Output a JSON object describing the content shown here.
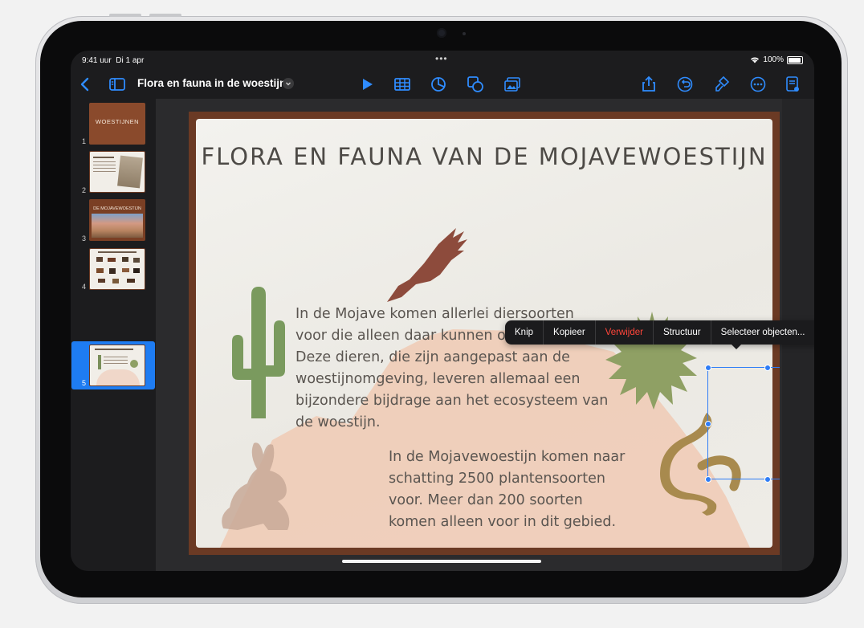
{
  "status": {
    "time": "9:41 uur",
    "date": "Di 1 apr",
    "battery": "100%"
  },
  "toolbar": {
    "document_title": "Flora en fauna in de woestijn",
    "icons": [
      "back-chevron-icon",
      "sidebar-icon",
      "play-icon",
      "table-icon",
      "chart-icon",
      "shape-icon",
      "media-icon",
      "share-icon",
      "undo-icon",
      "format-brush-icon",
      "more-icon",
      "document-icon"
    ]
  },
  "sidebar": {
    "slides": [
      {
        "number": "1",
        "label": "WOESTIJNEN"
      },
      {
        "number": "2",
        "label": ""
      },
      {
        "number": "3",
        "label": "DE MOJAVEWOESTIJN"
      },
      {
        "number": "4",
        "label": ""
      },
      {
        "number": "5",
        "label": ""
      }
    ],
    "selected": 5
  },
  "slide": {
    "title": "FLORA EN FAUNA VAN DE MOJAVEWOESTIJN",
    "text1": [
      "In de Mojave komen allerlei diersoorten",
      "voor die alleen daar kunnen overleven.",
      "Deze dieren, die zijn aangepast aan de",
      "woestijnomgeving, leveren allemaal een",
      "bijzondere bijdrage aan het ecosysteem van",
      "de woestijn."
    ],
    "text2": [
      "In de Mojavewoestijn komen naar",
      "schatting 2500 plantensoorten",
      "voor. Meer dan 200 soorten",
      "komen alleen voor in dit gebied."
    ]
  },
  "context_menu": {
    "items": [
      "Knip",
      "Kopieer",
      "Verwijder",
      "Structuur",
      "Selecteer objecten..."
    ],
    "more": "›"
  },
  "colors": {
    "accent": "#1e7cf2",
    "danger": "#ff453a",
    "slide_border": "#6b3a24"
  }
}
